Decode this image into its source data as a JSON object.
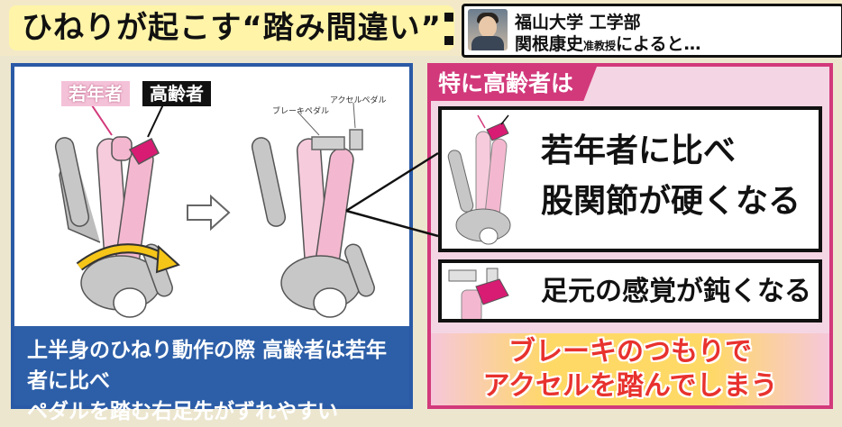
{
  "title": "ひねりが起こす“踏み間違い”",
  "speaker": {
    "line1": "福山大学 工学部",
    "name": "関根康史",
    "role": "准教授",
    "suffix": "によると…"
  },
  "left_panel": {
    "tag_young": "若年者",
    "tag_old": "高齢者",
    "pedal_brake": "ブレーキペダル",
    "pedal_accel": "アクセルペダル",
    "caption_line1": "上半身のひねり動作の際 高齢者は若年者に比べ",
    "caption_line2": "ペダルを踏む右足先がずれやすい"
  },
  "right_panel": {
    "header": "特に高齢者は",
    "card1_line1": "若年者に比べ",
    "card1_line2": "股関節が硬くなる",
    "card2_text": "足元の感覚が鈍くなる",
    "warning_line1": "ブレーキのつもりで",
    "warning_line2": "アクセルを踏んでしまう"
  },
  "colors": {
    "blue": "#2d5fa8",
    "pink": "#d2397b",
    "magenta_leg": "#d81b73",
    "yellow": "#ffd966",
    "warning_red": "#e8322e"
  }
}
